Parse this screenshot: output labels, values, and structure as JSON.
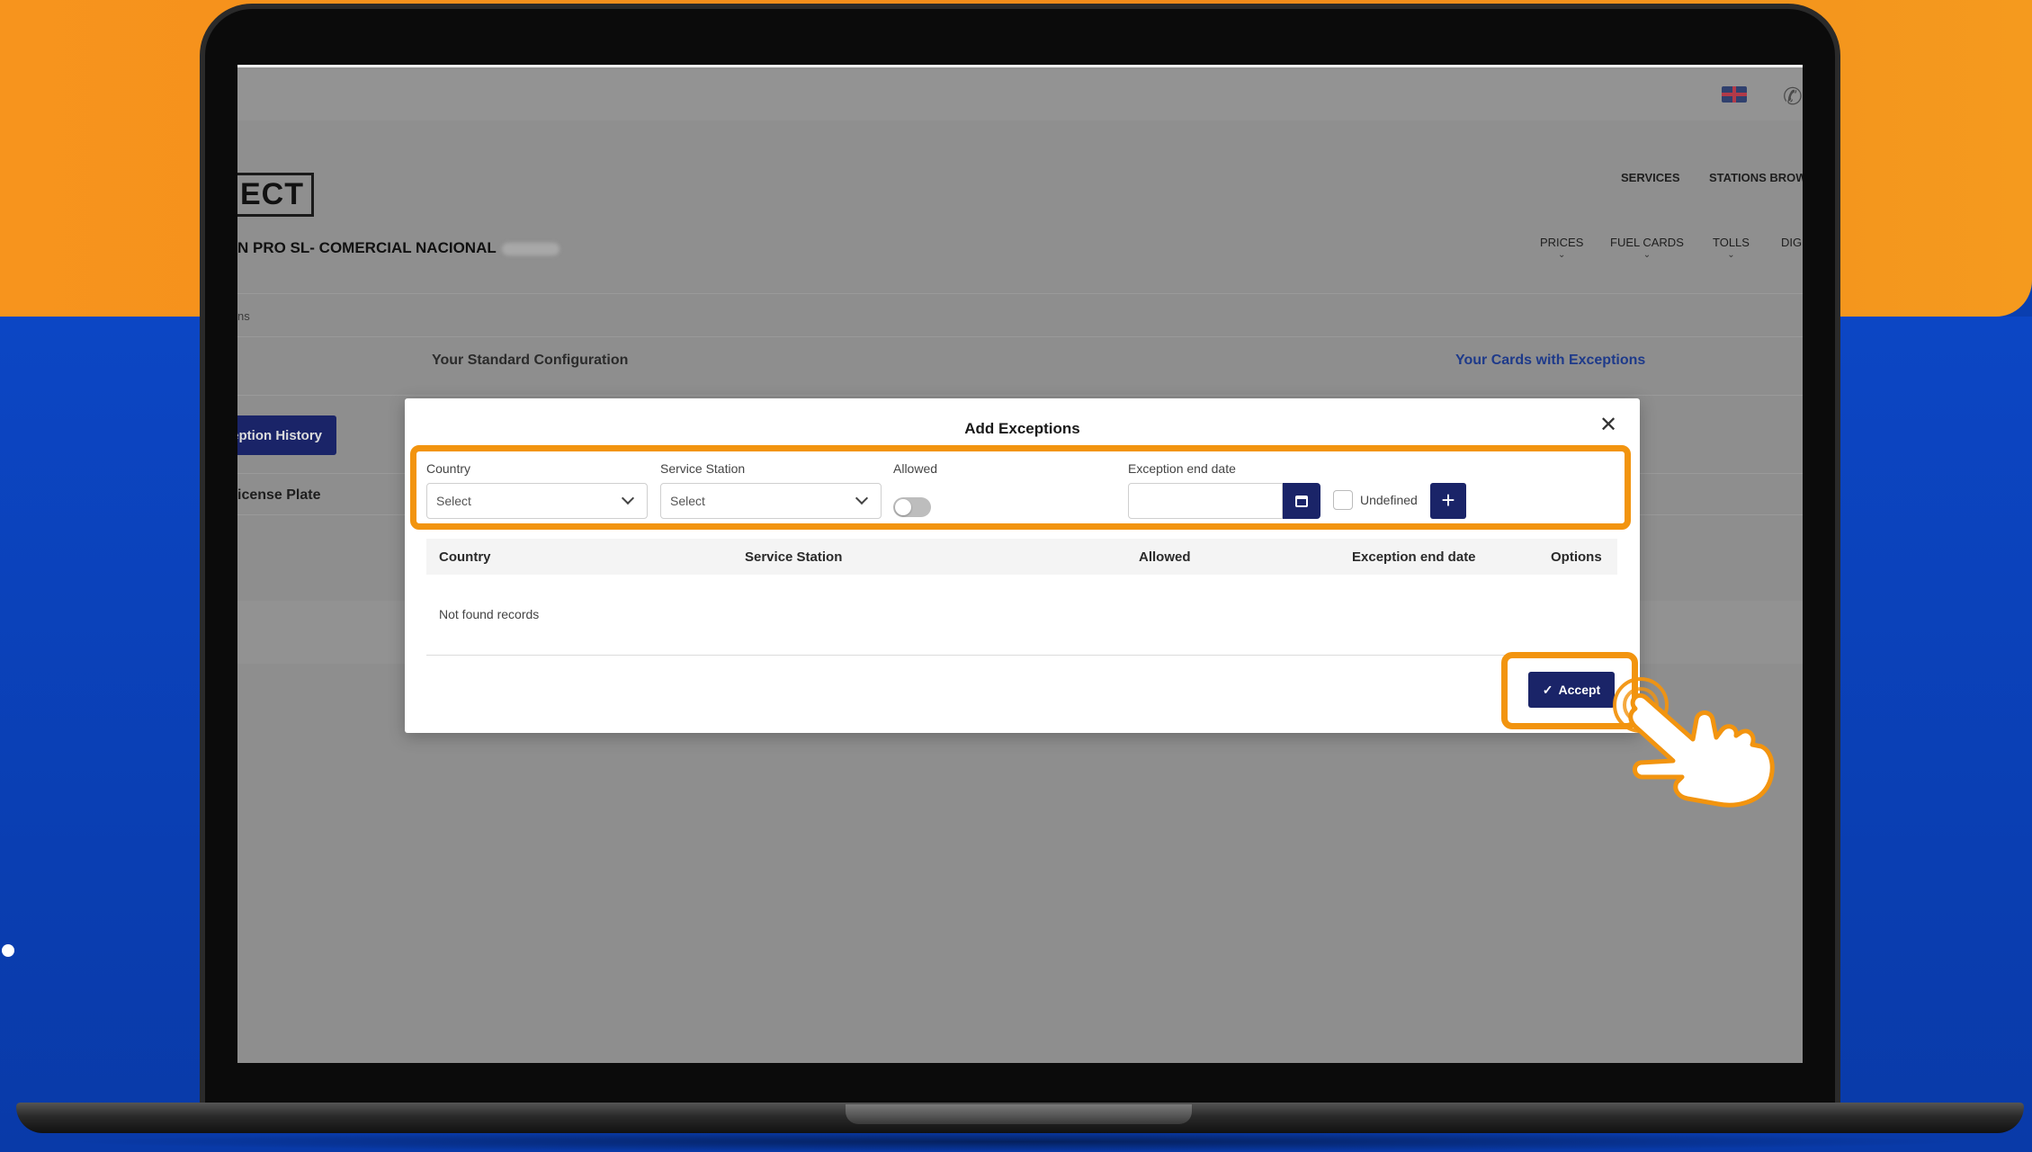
{
  "app": {
    "logo": "ECT",
    "company": "N PRO SL- COMERCIAL NACIONAL",
    "flag_icon": "uk-flag-icon",
    "phone_icon": "phone-icon"
  },
  "nav": {
    "top": [
      "SERVICES",
      "STATIONS BROW"
    ],
    "sub": [
      "PRICES",
      "FUEL CARDS",
      "TOLLS",
      "DIGI"
    ]
  },
  "breadcrumb": "ns",
  "tabs": {
    "standard": "Your Standard Configuration",
    "cards": "Your Cards with Exceptions"
  },
  "page": {
    "history_button": "eption History",
    "license_label": "icense Plate"
  },
  "modal": {
    "title": "Add Exceptions",
    "fields": {
      "country_label": "Country",
      "country_value": "Select",
      "station_label": "Service Station",
      "station_value": "Select",
      "allowed_label": "Allowed",
      "allowed_on": false,
      "end_date_label": "Exception end date",
      "end_date_value": "",
      "undefined_label": "Undefined",
      "undefined_checked": false,
      "add_button": "+"
    },
    "table": {
      "columns": [
        "Country",
        "Service Station",
        "Allowed",
        "Exception end date",
        "Options"
      ],
      "rows": [],
      "empty_text": "Not found records"
    },
    "accept_label": "Accept"
  },
  "colors": {
    "orange": "#f7941d",
    "blue": "#0c46c4",
    "navy_button": "#1a2468",
    "highlight": "#f2940f"
  }
}
